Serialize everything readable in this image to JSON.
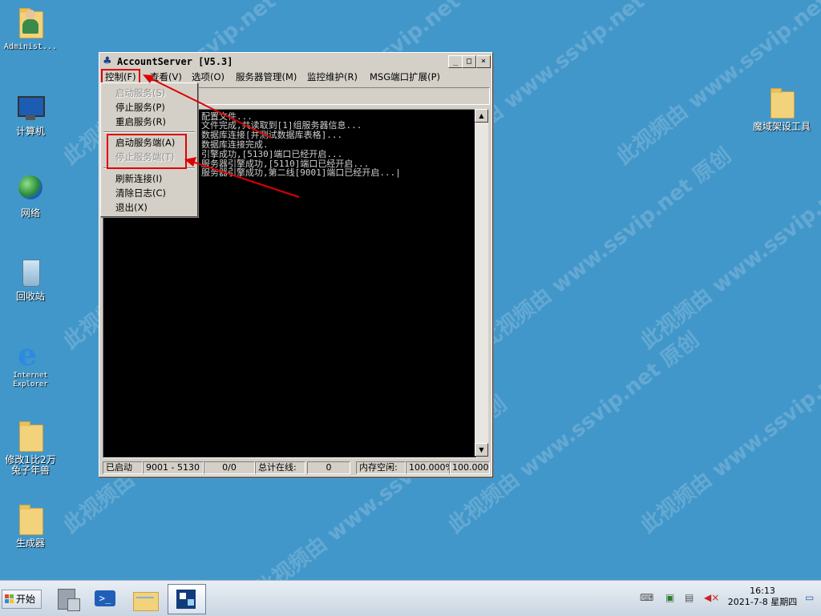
{
  "desktop": {
    "watermark": "此视频由 www.ssvip.net 原创",
    "icons": [
      {
        "name": "administrator",
        "label": "Administ..."
      },
      {
        "name": "computer",
        "label": "计算机"
      },
      {
        "name": "network",
        "label": "网络"
      },
      {
        "name": "recycle-bin",
        "label": "回收站"
      },
      {
        "name": "internet-explorer",
        "label": "Internet Explorer"
      },
      {
        "name": "folder-mod",
        "label": "修改1比2万兔子年兽"
      },
      {
        "name": "folder-generator",
        "label": "生成器"
      },
      {
        "name": "folder-moyu",
        "label": "魔域架设工具"
      }
    ]
  },
  "window": {
    "title": "AccountServer [V5.3]",
    "min_btn": "_",
    "max_btn": "□",
    "close_btn": "×",
    "menu": [
      {
        "label": "控制(F)"
      },
      {
        "label": "查看(V)"
      },
      {
        "label": "选项(O)"
      },
      {
        "label": "服务器管理(M)"
      },
      {
        "label": "监控维护(R)"
      },
      {
        "label": "MSG端口扩展(P)"
      }
    ],
    "console_lines": [
      "配置文件...",
      "文件完成,共读取到[1]组服务器信息...",
      "数据库连接[并测试数据库表格]...",
      "数据库连接完成.",
      "引擎成功,[5130]端口已经开启...",
      "服务器引擎成功,[5110]端口已经开启...",
      "服务器引擎成功,第二线[9001]端口已经开启...|"
    ],
    "status": {
      "state": "已启动",
      "ports": "9001 - 5130",
      "count": "0/0",
      "online_label": "总计在线:",
      "online_value": "0",
      "memory_label": "内存空闲:",
      "memory_value1": "100.000%",
      "memory_value2": "100.000%"
    }
  },
  "dropdown": {
    "items": [
      {
        "label": "启动服务(S)",
        "disabled": true
      },
      {
        "label": "停止服务(P)",
        "disabled": false
      },
      {
        "label": "重启服务(R)",
        "disabled": false
      },
      {
        "label": "启动服务端(A)",
        "disabled": false
      },
      {
        "label": "停止服务端(T)",
        "disabled": true
      },
      {
        "label": "刷新连接(I)",
        "disabled": false
      },
      {
        "label": "清除日志(C)",
        "disabled": false
      },
      {
        "label": "退出(X)",
        "disabled": false
      }
    ]
  },
  "taskbar": {
    "start_label": "开始",
    "time": "16:13",
    "date": "2021-7-8 星期四"
  },
  "colors": {
    "annotation": "#e00000",
    "desktop": "#4297ca"
  }
}
